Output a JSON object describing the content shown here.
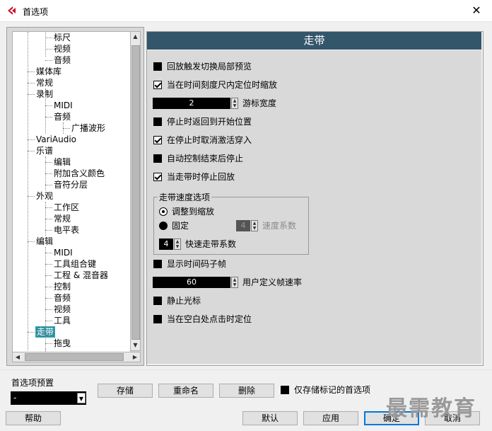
{
  "window": {
    "title": "首选项",
    "close_label": "✕"
  },
  "tree": {
    "items": [
      {
        "label": "标尺",
        "indent": 2
      },
      {
        "label": "视频",
        "indent": 2
      },
      {
        "label": "音频",
        "indent": 2
      },
      {
        "label": "媒体库",
        "indent": 1
      },
      {
        "label": "常规",
        "indent": 1
      },
      {
        "label": "录制",
        "indent": 1
      },
      {
        "label": "MIDI",
        "indent": 2
      },
      {
        "label": "音频",
        "indent": 2
      },
      {
        "label": "广播波形",
        "indent": 3
      },
      {
        "label": "VariAudio",
        "indent": 1
      },
      {
        "label": "乐谱",
        "indent": 1
      },
      {
        "label": "编辑",
        "indent": 2
      },
      {
        "label": "附加含义颜色",
        "indent": 2
      },
      {
        "label": "音符分层",
        "indent": 2
      },
      {
        "label": "外观",
        "indent": 1
      },
      {
        "label": "工作区",
        "indent": 2
      },
      {
        "label": "常规",
        "indent": 2
      },
      {
        "label": "电平表",
        "indent": 2
      },
      {
        "label": "编辑",
        "indent": 1
      },
      {
        "label": "MIDI",
        "indent": 2
      },
      {
        "label": "工具组合键",
        "indent": 2
      },
      {
        "label": "工程 & 混音器",
        "indent": 2
      },
      {
        "label": "控制",
        "indent": 2
      },
      {
        "label": "音频",
        "indent": 2
      },
      {
        "label": "视频",
        "indent": 2
      },
      {
        "label": "工具",
        "indent": 2
      },
      {
        "label": "走带",
        "indent": 1,
        "selected": true
      },
      {
        "label": "拖曳",
        "indent": 2
      }
    ]
  },
  "panel": {
    "header": "走带",
    "options": {
      "o1": "回放触发切换局部预览",
      "o2": "当在时间刻度尺内定位时缩放",
      "cursor_width_value": "2",
      "cursor_width_label": "游标宽度",
      "o3": "停止时返回到开始位置",
      "o4": "在停止时取消激活穿入",
      "o5": "自动控制结束后停止",
      "o6": "当走带时停止回放",
      "o7": "显示时间码子帧",
      "fps_value": "60",
      "fps_label": "用户定义帧速率",
      "o8": "静止光标",
      "o9": "当在空白处点击时定位"
    },
    "checked": {
      "o1": false,
      "o2": true,
      "o3": false,
      "o4": true,
      "o5": false,
      "o6": true,
      "o7": false,
      "o8": false,
      "o9": false
    },
    "speed_group": {
      "title": "走带速度选项",
      "radio_zoom": "调整到缩放",
      "radio_fixed": "固定",
      "speed_factor_value": "4",
      "speed_factor_label": "速度系数",
      "ff_value": "4",
      "ff_label": "快速走带系数"
    }
  },
  "bottom": {
    "preset_label": "首选项预置",
    "preset_value": "-",
    "store_btn": "存储",
    "rename_btn": "重命名",
    "delete_btn": "删除",
    "marked_only_label": "仅存储标记的首选项",
    "help_btn": "帮助",
    "default_btn": "默认",
    "apply_btn": "应用",
    "ok_btn": "确定",
    "cancel_btn": "取消",
    "watermark": "最需教育"
  }
}
